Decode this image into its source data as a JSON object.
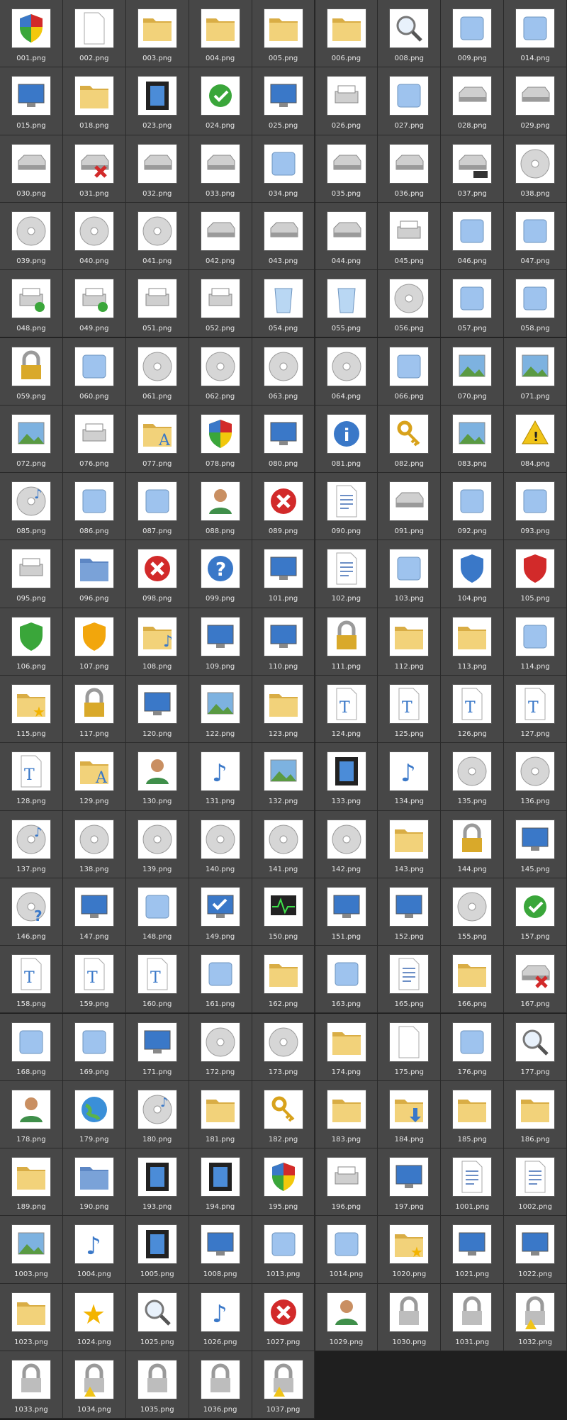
{
  "files": [
    {
      "name": "001.png",
      "icon": "shield-icon"
    },
    {
      "name": "002.png",
      "icon": "blank-page-icon"
    },
    {
      "name": "003.png",
      "icon": "folder-icon"
    },
    {
      "name": "004.png",
      "icon": "folder-icon"
    },
    {
      "name": "005.png",
      "icon": "folder-icon"
    },
    {
      "name": "006.png",
      "icon": "folder-icon"
    },
    {
      "name": "008.png",
      "icon": "magnifier-icon"
    },
    {
      "name": "009.png",
      "icon": "blue-sheet-icon"
    },
    {
      "name": "014.png",
      "icon": "puzzle-chess-icon"
    },
    {
      "name": "015.png",
      "icon": "window-icon"
    },
    {
      "name": "018.png",
      "icon": "folder-search-icon"
    },
    {
      "name": "023.png",
      "icon": "film-icon"
    },
    {
      "name": "024.png",
      "icon": "check-circle-icon"
    },
    {
      "name": "025.png",
      "icon": "globe-monitor-icon"
    },
    {
      "name": "026.png",
      "icon": "printer-icon"
    },
    {
      "name": "027.png",
      "icon": "presentation-icon"
    },
    {
      "name": "028.png",
      "icon": "drive-icon"
    },
    {
      "name": "029.png",
      "icon": "drive-icon"
    },
    {
      "name": "030.png",
      "icon": "drive-icon"
    },
    {
      "name": "031.png",
      "icon": "drive-error-icon"
    },
    {
      "name": "032.png",
      "icon": "drive-icon"
    },
    {
      "name": "033.png",
      "icon": "drive-icon"
    },
    {
      "name": "034.png",
      "icon": "chip-icon"
    },
    {
      "name": "035.png",
      "icon": "drive-icon"
    },
    {
      "name": "036.png",
      "icon": "drive-icon"
    },
    {
      "name": "037.png",
      "icon": "dvd-drive-icon"
    },
    {
      "name": "038.png",
      "icon": "disc-icon"
    },
    {
      "name": "039.png",
      "icon": "disc-icon"
    },
    {
      "name": "040.png",
      "icon": "disc-icon"
    },
    {
      "name": "041.png",
      "icon": "disc-icon"
    },
    {
      "name": "042.png",
      "icon": "drive-icon"
    },
    {
      "name": "043.png",
      "icon": "drive-icon"
    },
    {
      "name": "044.png",
      "icon": "drive-icon"
    },
    {
      "name": "045.png",
      "icon": "globe-printer-icon"
    },
    {
      "name": "046.png",
      "icon": "camcorder-icon"
    },
    {
      "name": "047.png",
      "icon": "phone-icon"
    },
    {
      "name": "048.png",
      "icon": "printer-check-icon"
    },
    {
      "name": "049.png",
      "icon": "printer-check-icon"
    },
    {
      "name": "051.png",
      "icon": "printer-icon"
    },
    {
      "name": "052.png",
      "icon": "printer-icon"
    },
    {
      "name": "054.png",
      "icon": "recycle-bin-icon"
    },
    {
      "name": "055.png",
      "icon": "recycle-bin-icon"
    },
    {
      "name": "056.png",
      "icon": "disc-icon"
    },
    {
      "name": "057.png",
      "icon": "camera-icon"
    },
    {
      "name": "058.png",
      "icon": "mouse-icon"
    },
    {
      "name": "059.png",
      "icon": "lock-icon"
    },
    {
      "name": "060.png",
      "icon": "memory-card-icon"
    },
    {
      "name": "061.png",
      "icon": "disc-icon"
    },
    {
      "name": "062.png",
      "icon": "disc-icon"
    },
    {
      "name": "063.png",
      "icon": "disc-icon"
    },
    {
      "name": "064.png",
      "icon": "disc-icon"
    },
    {
      "name": "066.png",
      "icon": "media-player-icon"
    },
    {
      "name": "070.png",
      "icon": "picture-icon"
    },
    {
      "name": "071.png",
      "icon": "picture-icon"
    },
    {
      "name": "072.png",
      "icon": "picture-icon"
    },
    {
      "name": "076.png",
      "icon": "printer-icon"
    },
    {
      "name": "077.png",
      "icon": "font-folder-icon"
    },
    {
      "name": "078.png",
      "icon": "shield-icon"
    },
    {
      "name": "080.png",
      "icon": "start-menu-icon"
    },
    {
      "name": "081.png",
      "icon": "info-icon"
    },
    {
      "name": "082.png",
      "icon": "key-icon"
    },
    {
      "name": "083.png",
      "icon": "flower-icon"
    },
    {
      "name": "084.png",
      "icon": "warning-icon"
    },
    {
      "name": "085.png",
      "icon": "music-disc-icon"
    },
    {
      "name": "086.png",
      "icon": "sync-icon"
    },
    {
      "name": "087.png",
      "icon": "installer-icon"
    },
    {
      "name": "088.png",
      "icon": "users-icon"
    },
    {
      "name": "089.png",
      "icon": "close-icon"
    },
    {
      "name": "090.png",
      "icon": "document-icon"
    },
    {
      "name": "091.png",
      "icon": "drive-icon"
    },
    {
      "name": "092.png",
      "icon": "blue-sheet-icon"
    },
    {
      "name": "093.png",
      "icon": "pda-icon"
    },
    {
      "name": "095.png",
      "icon": "scanner-icon"
    },
    {
      "name": "096.png",
      "icon": "blue-folder-icon"
    },
    {
      "name": "098.png",
      "icon": "error-icon"
    },
    {
      "name": "099.png",
      "icon": "help-icon"
    },
    {
      "name": "101.png",
      "icon": "monitor-icon"
    },
    {
      "name": "102.png",
      "icon": "document-icon"
    },
    {
      "name": "103.png",
      "icon": "projector-screen-icon"
    },
    {
      "name": "104.png",
      "icon": "shield-help-icon"
    },
    {
      "name": "105.png",
      "icon": "shield-error-icon"
    },
    {
      "name": "106.png",
      "icon": "shield-check-icon"
    },
    {
      "name": "107.png",
      "icon": "shield-warning-icon"
    },
    {
      "name": "108.png",
      "icon": "music-folder-icon"
    },
    {
      "name": "109.png",
      "icon": "monitor-icon"
    },
    {
      "name": "110.png",
      "icon": "monitor-icon"
    },
    {
      "name": "111.png",
      "icon": "blocks-icon"
    },
    {
      "name": "112.png",
      "icon": "folder-icon"
    },
    {
      "name": "113.png",
      "icon": "picture-folder-icon"
    },
    {
      "name": "114.png",
      "icon": "settings-icon"
    },
    {
      "name": "115.png",
      "icon": "favorites-folder-icon"
    },
    {
      "name": "117.png",
      "icon": "clock-icon"
    },
    {
      "name": "120.png",
      "icon": "network-icon"
    },
    {
      "name": "122.png",
      "icon": "picture-icon"
    },
    {
      "name": "123.png",
      "icon": "user-folder-icon"
    },
    {
      "name": "124.png",
      "icon": "font-icon"
    },
    {
      "name": "125.png",
      "icon": "font-icon"
    },
    {
      "name": "126.png",
      "icon": "font-icon"
    },
    {
      "name": "127.png",
      "icon": "font-icon"
    },
    {
      "name": "128.png",
      "icon": "font-icon"
    },
    {
      "name": "129.png",
      "icon": "font-folder-icon"
    },
    {
      "name": "130.png",
      "icon": "briefcase-user-icon"
    },
    {
      "name": "131.png",
      "icon": "music-note-icon"
    },
    {
      "name": "132.png",
      "icon": "picture-icon"
    },
    {
      "name": "133.png",
      "icon": "film-icon"
    },
    {
      "name": "134.png",
      "icon": "music-note-icon"
    },
    {
      "name": "135.png",
      "icon": "disc-icon"
    },
    {
      "name": "136.png",
      "icon": "disc-icon"
    },
    {
      "name": "137.png",
      "icon": "music-disc-icon"
    },
    {
      "name": "138.png",
      "icon": "disc-icon"
    },
    {
      "name": "139.png",
      "icon": "disc-icon"
    },
    {
      "name": "140.png",
      "icon": "disc-icon"
    },
    {
      "name": "141.png",
      "icon": "disc-icon"
    },
    {
      "name": "142.png",
      "icon": "disc-icon"
    },
    {
      "name": "143.png",
      "icon": "folder-icon"
    },
    {
      "name": "144.png",
      "icon": "globe-clock-icon"
    },
    {
      "name": "145.png",
      "icon": "monitor-search-icon"
    },
    {
      "name": "146.png",
      "icon": "disc-help-icon"
    },
    {
      "name": "147.png",
      "icon": "monitor-icon"
    },
    {
      "name": "148.png",
      "icon": "blue-sheet-icon"
    },
    {
      "name": "149.png",
      "icon": "monitor-check-icon"
    },
    {
      "name": "150.png",
      "icon": "activity-monitor-icon"
    },
    {
      "name": "151.png",
      "icon": "monitor-icon"
    },
    {
      "name": "152.png",
      "icon": "network-icon"
    },
    {
      "name": "155.png",
      "icon": "disc-icon"
    },
    {
      "name": "157.png",
      "icon": "check-icon"
    },
    {
      "name": "158.png",
      "icon": "font-icon"
    },
    {
      "name": "159.png",
      "icon": "font-icon"
    },
    {
      "name": "160.png",
      "icon": "font-icon"
    },
    {
      "name": "161.png",
      "icon": "installer-icon"
    },
    {
      "name": "162.png",
      "icon": "zip-folder-icon"
    },
    {
      "name": "163.png",
      "icon": "shortcut-arrow-icon"
    },
    {
      "name": "165.png",
      "icon": "checklist-icon"
    },
    {
      "name": "166.png",
      "icon": "folder-icon"
    },
    {
      "name": "167.png",
      "icon": "drive-error-icon"
    },
    {
      "name": "168.png",
      "icon": "games-icon"
    },
    {
      "name": "169.png",
      "icon": "download-icon"
    },
    {
      "name": "171.png",
      "icon": "network-icon"
    },
    {
      "name": "172.png",
      "icon": "disc-icon"
    },
    {
      "name": "173.png",
      "icon": "disc-icon"
    },
    {
      "name": "174.png",
      "icon": "zip-folder-icon"
    },
    {
      "name": "175.png",
      "icon": "zip-icon"
    },
    {
      "name": "176.png",
      "icon": "speaker-icon"
    },
    {
      "name": "177.png",
      "icon": "magnifier-icon"
    },
    {
      "name": "178.png",
      "icon": "users-icon"
    },
    {
      "name": "179.png",
      "icon": "globe-icon"
    },
    {
      "name": "180.png",
      "icon": "music-disc-icon"
    },
    {
      "name": "181.png",
      "icon": "folder-icon"
    },
    {
      "name": "182.png",
      "icon": "keyboard-icon"
    },
    {
      "name": "183.png",
      "icon": "folder-icon"
    },
    {
      "name": "184.png",
      "icon": "download-folder-icon"
    },
    {
      "name": "185.png",
      "icon": "folder-icon"
    },
    {
      "name": "186.png",
      "icon": "games-folder-icon"
    },
    {
      "name": "189.png",
      "icon": "video-folder-icon"
    },
    {
      "name": "190.png",
      "icon": "blue-folder-icon"
    },
    {
      "name": "193.png",
      "icon": "film-strip-icon"
    },
    {
      "name": "194.png",
      "icon": "film-strip-icon"
    },
    {
      "name": "195.png",
      "icon": "shield-pie-icon"
    },
    {
      "name": "196.png",
      "icon": "printer-icon"
    },
    {
      "name": "197.png",
      "icon": "monitor-icon"
    },
    {
      "name": "1001.png",
      "icon": "document-icon"
    },
    {
      "name": "1002.png",
      "icon": "document-icon"
    },
    {
      "name": "1003.png",
      "icon": "picture-icon"
    },
    {
      "name": "1004.png",
      "icon": "music-note-icon"
    },
    {
      "name": "1005.png",
      "icon": "film-icon"
    },
    {
      "name": "1008.png",
      "icon": "monitor-icon"
    },
    {
      "name": "1013.png",
      "icon": "molecule-icon"
    },
    {
      "name": "1014.png",
      "icon": "blue-sheet-icon"
    },
    {
      "name": "1020.png",
      "icon": "favorites-folder-icon"
    },
    {
      "name": "1021.png",
      "icon": "monitor-icon"
    },
    {
      "name": "1022.png",
      "icon": "monitor-icon"
    },
    {
      "name": "1023.png",
      "icon": "explorer-folder-icon"
    },
    {
      "name": "1024.png",
      "icon": "star-icon"
    },
    {
      "name": "1025.png",
      "icon": "magnifier-icon"
    },
    {
      "name": "1026.png",
      "icon": "music-note-icon"
    },
    {
      "name": "1027.png",
      "icon": "no-entry-icon"
    },
    {
      "name": "1029.png",
      "icon": "user-icon"
    },
    {
      "name": "1030.png",
      "icon": "padlock-icon"
    },
    {
      "name": "1031.png",
      "icon": "padlock-icon"
    },
    {
      "name": "1032.png",
      "icon": "padlock-warning-icon"
    },
    {
      "name": "1033.png",
      "icon": "padlock-icon"
    },
    {
      "name": "1034.png",
      "icon": "padlock-warning-icon"
    },
    {
      "name": "1035.png",
      "icon": "padlock-icon"
    },
    {
      "name": "1036.png",
      "icon": "padlock-icon"
    },
    {
      "name": "1037.png",
      "icon": "padlock-warning-icon"
    }
  ]
}
